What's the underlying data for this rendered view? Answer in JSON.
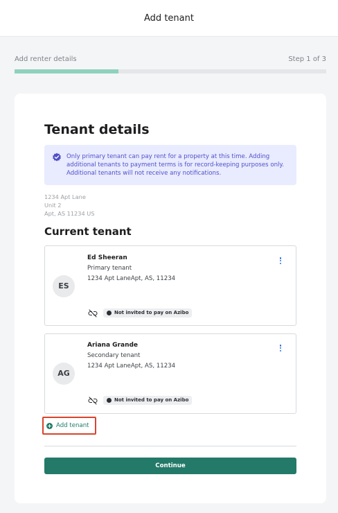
{
  "header": {
    "title": "Add tenant"
  },
  "progress": {
    "label": "Add renter details",
    "step": "Step 1 of 3",
    "fraction": 0.333
  },
  "main": {
    "title": "Tenant details",
    "info_banner": {
      "icon": "check-badge-icon",
      "lines": [
        "Only primary tenant can pay rent for a property at this time. Adding",
        "additional tenants to payment terms is for record-keeping purposes only.",
        "Additional tenants will not receive any notifications."
      ]
    },
    "property_address": [
      "1234 Apt Lane",
      "Unit 2",
      "Apt, AS 11234 US"
    ],
    "current_tenant_heading": "Current tenant",
    "tenants": [
      {
        "initials": "ES",
        "name": "Ed Sheeran",
        "role": "Primary tenant",
        "address": "1234 Apt LaneApt, AS, 11234",
        "status": "Not invited to pay on Azibo"
      },
      {
        "initials": "AG",
        "name": "Ariana Grande",
        "role": "Secondary tenant",
        "address": "1234 Apt LaneApt, AS, 11234",
        "status": "Not invited to pay on Azibo"
      }
    ],
    "add_tenant_label": "Add tenant",
    "continue_label": "Continue"
  },
  "colors": {
    "accent": "#247a68",
    "progress_fill": "#8ed1bc",
    "info_bg": "#e9ebff",
    "info_text": "#4f50c9",
    "highlight": "#d9442b"
  }
}
